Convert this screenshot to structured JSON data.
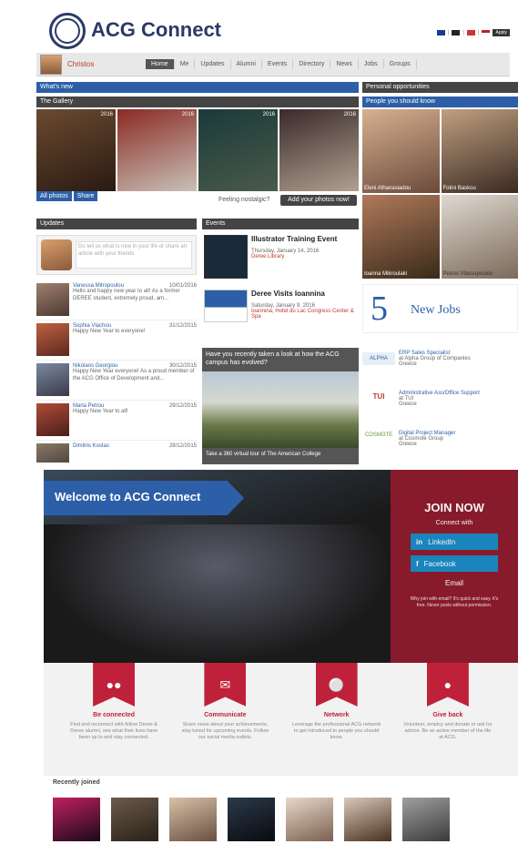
{
  "header": {
    "app_title": "ACG Connect",
    "lang_button": "Apply"
  },
  "nav": {
    "user_name": "Christos",
    "items": [
      "Home",
      "Me",
      "Updates",
      "Alumni",
      "Events",
      "Directory",
      "News",
      "Jobs",
      "Groups"
    ]
  },
  "whats_new": {
    "title": "What's new",
    "gallery_title": "The Gallery",
    "gallery_years": [
      "2016",
      "2016",
      "2016",
      "2016"
    ],
    "tags": [
      "All photos",
      "Share"
    ],
    "feeling_nostalgic": "Feeling nostalgic?",
    "add_photos_button": "Add your photos now!"
  },
  "updates": {
    "title": "Updates",
    "compose_placeholder": "Do tell us what is new in your life or share an article with your friends",
    "items": [
      {
        "name": "Vanessa Mitropoulou",
        "date": "10/01/2016",
        "text": "Hello and happy new year to all! As a former DEREE student, extremely proud, am..."
      },
      {
        "name": "Sophia Vlachou",
        "date": "31/12/2015",
        "text": "Happy New Year to everyone!"
      },
      {
        "name": "Nikolaos Georgiou",
        "date": "30/12/2015",
        "text": "Happy New Year everyone! As a proud member of the ACG Office of Development and..."
      },
      {
        "name": "Maria Petrou",
        "date": "29/12/2015",
        "text": "Happy New Year to all!"
      },
      {
        "name": "Dimitris Kostas",
        "date": "28/12/2015",
        "text": ""
      }
    ]
  },
  "events": {
    "title": "Events",
    "items": [
      {
        "title": "Illustrator Training Event",
        "date": "Thursday, January 14, 2016",
        "place": "Deree Library"
      },
      {
        "title": "Deree Visits Ioannina",
        "date": "Saturday, January 9, 2016",
        "place": "Ioannina, Hotel du Lac Congress Center & Spa"
      }
    ],
    "promo_text": "Have you recently taken a look at how the ACG campus has evolved?",
    "promo_caption": "Take a 360 virtual tour of The American College"
  },
  "personal": {
    "title": "Personal opportunities",
    "people_title": "People you should know",
    "people": [
      {
        "name": "Eleni Athanasiadou"
      },
      {
        "name": "Fotini Baskou"
      },
      {
        "name": "Ioanna Mikroulaki"
      },
      {
        "name": "Petros Vlassopoulos"
      }
    ],
    "jobs_count": "5",
    "jobs_label": "New Jobs",
    "jobs": [
      {
        "title": "ERP Sales Specialist",
        "company": "at Alpha Group of Companies",
        "location": "Greece"
      },
      {
        "title": "Administrative Ass/Office Support",
        "company": "at TUI",
        "location": "Greece"
      },
      {
        "title": "Digital Project Manager",
        "company": "at Cosmote Group",
        "location": "Greece"
      }
    ]
  },
  "landing": {
    "welcome": "Welcome to ACG Connect",
    "join_title": "JOIN NOW",
    "connect_with": "Connect with",
    "linkedin": "LinkedIn",
    "facebook": "Facebook",
    "email": "Email",
    "fine_print": "Why join with email? It's quick and easy. It's free. Never posts without permission."
  },
  "features": [
    {
      "title": "Be connected",
      "desc": "Find and reconnect with fellow Deree & Deree alumni, see what their lives have been up to and stay connected."
    },
    {
      "title": "Communicate",
      "desc": "Share news about your achievements, stay tuned for upcoming events. Follow our social media outlets."
    },
    {
      "title": "Network",
      "desc": "Leverage the professional ACG network to get introduced to people you should know."
    },
    {
      "title": "Give back",
      "desc": "Volunteer, employ and donate or ask for advice. Be an active member of the life at ACG."
    }
  ],
  "recently_joined": {
    "title": "Recently joined"
  },
  "colors": {
    "brand_navy": "#2b3a67",
    "accent_blue": "#2d5fa8",
    "accent_red": "#c0213a"
  }
}
